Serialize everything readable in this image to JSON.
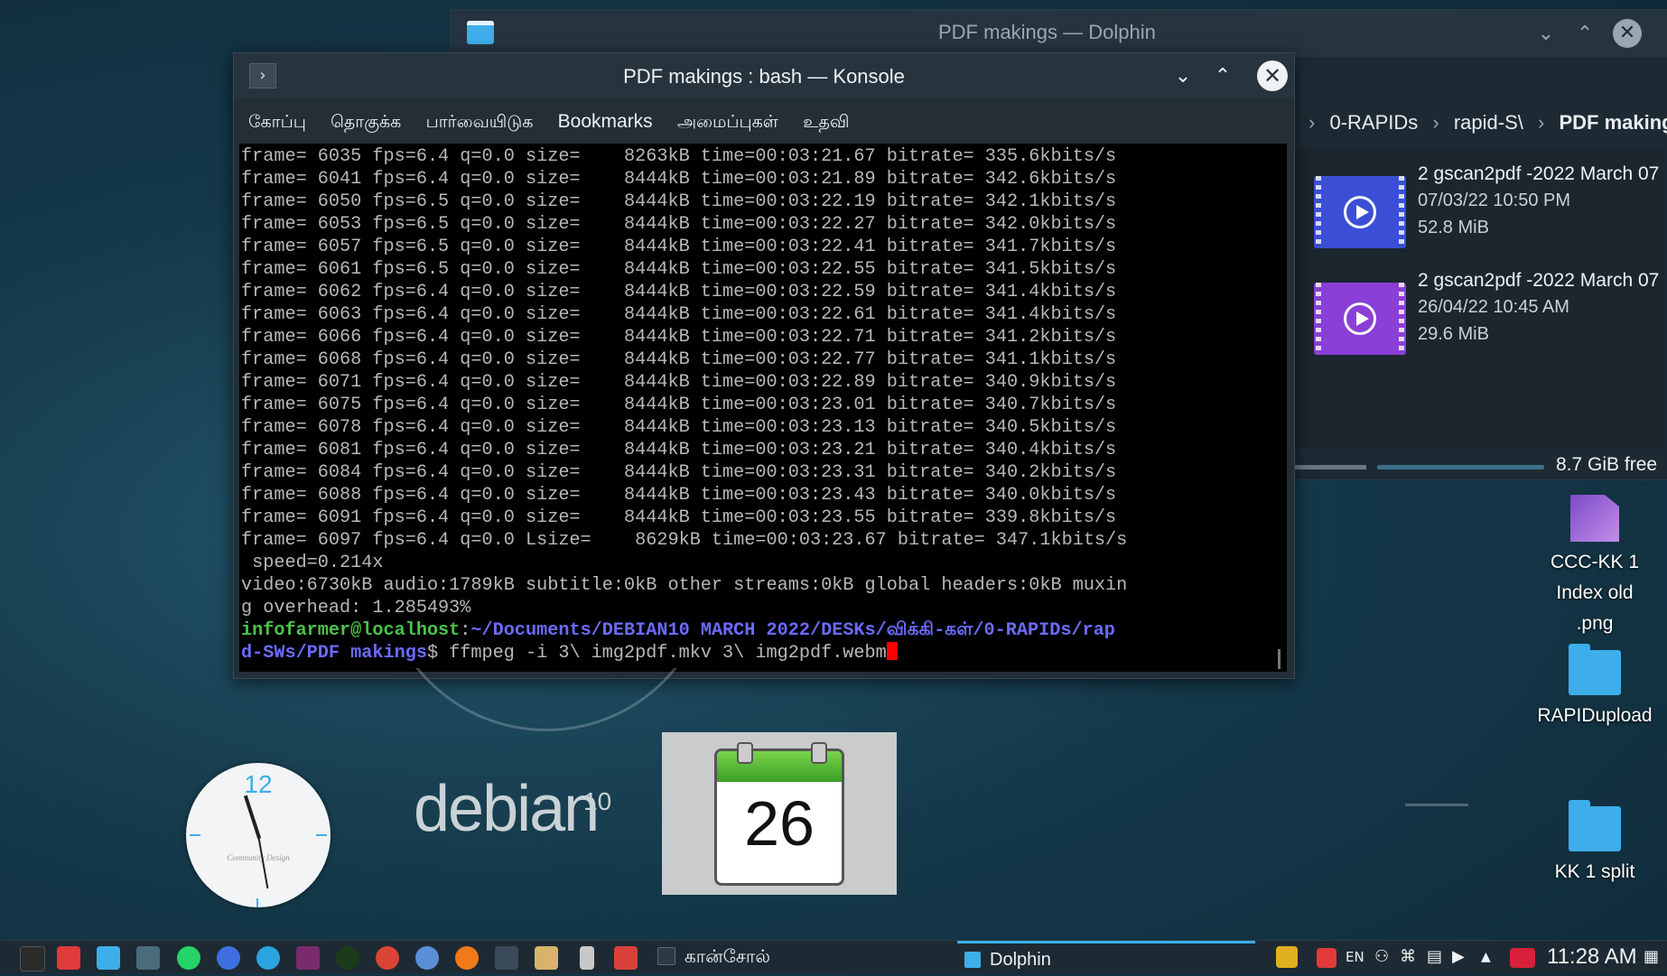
{
  "dolphin": {
    "title": "PDF makings — Dolphin",
    "breadcrumbs": [
      "0-RAPIDs",
      "rapid-S\\",
      "PDF makings"
    ],
    "files": [
      {
        "name": "2 gscan2pdf -2022 March 07",
        "date": "07/03/22 10:50 PM",
        "size": "52.8 MiB",
        "color": "#3b4fd6"
      },
      {
        "name": "2 gscan2pdf -2022 March 07",
        "date": "26/04/22 10:45 AM",
        "size": "29.6 MiB",
        "color": "#8a3fd6"
      }
    ],
    "side_char": "v",
    "free_space": "8.7 GiB free"
  },
  "konsole": {
    "title": "PDF makings : bash — Konsole",
    "menu": [
      "கோப்பு",
      "தொகுக்க",
      "பார்வையிடுக",
      "Bookmarks",
      "அமைப்புகள்",
      "உதவி"
    ],
    "output_lines": [
      "frame= 6035 fps=6.4 q=0.0 size=    8263kB time=00:03:21.67 bitrate= 335.6kbits/s",
      "frame= 6041 fps=6.4 q=0.0 size=    8444kB time=00:03:21.89 bitrate= 342.6kbits/s",
      "frame= 6050 fps=6.5 q=0.0 size=    8444kB time=00:03:22.19 bitrate= 342.1kbits/s",
      "frame= 6053 fps=6.5 q=0.0 size=    8444kB time=00:03:22.27 bitrate= 342.0kbits/s",
      "frame= 6057 fps=6.5 q=0.0 size=    8444kB time=00:03:22.41 bitrate= 341.7kbits/s",
      "frame= 6061 fps=6.5 q=0.0 size=    8444kB time=00:03:22.55 bitrate= 341.5kbits/s",
      "frame= 6062 fps=6.4 q=0.0 size=    8444kB time=00:03:22.59 bitrate= 341.4kbits/s",
      "frame= 6063 fps=6.4 q=0.0 size=    8444kB time=00:03:22.61 bitrate= 341.4kbits/s",
      "frame= 6066 fps=6.4 q=0.0 size=    8444kB time=00:03:22.71 bitrate= 341.2kbits/s",
      "frame= 6068 fps=6.4 q=0.0 size=    8444kB time=00:03:22.77 bitrate= 341.1kbits/s",
      "frame= 6071 fps=6.4 q=0.0 size=    8444kB time=00:03:22.89 bitrate= 340.9kbits/s",
      "frame= 6075 fps=6.4 q=0.0 size=    8444kB time=00:03:23.01 bitrate= 340.7kbits/s",
      "frame= 6078 fps=6.4 q=0.0 size=    8444kB time=00:03:23.13 bitrate= 340.5kbits/s",
      "frame= 6081 fps=6.4 q=0.0 size=    8444kB time=00:03:23.21 bitrate= 340.4kbits/s",
      "frame= 6084 fps=6.4 q=0.0 size=    8444kB time=00:03:23.31 bitrate= 340.2kbits/s",
      "frame= 6088 fps=6.4 q=0.0 size=    8444kB time=00:03:23.43 bitrate= 340.0kbits/s",
      "frame= 6091 fps=6.4 q=0.0 size=    8444kB time=00:03:23.55 bitrate= 339.8kbits/s",
      "frame= 6097 fps=6.4 q=0.0 Lsize=    8629kB time=00:03:23.67 bitrate= 347.1kbits/s",
      " speed=0.214x",
      "video:6730kB audio:1789kB subtitle:0kB other streams:0kB global headers:0kB muxin",
      "g overhead: 1.285493%"
    ],
    "prompt_user": "infofarmer@localhost",
    "prompt_sep": ":",
    "prompt_path_1": "~/Documents/DEBIAN10 MARCH 2022/DESKs/விக்கி-கள்/0-RAPIDs/rap",
    "prompt_path_2": "d-SWs/PDF makings",
    "prompt_dollar": "$ ",
    "command": "ffmpeg -i 3\\ img2pdf.mkv 3\\ img2pdf.webm"
  },
  "desktop": {
    "clock_twelve": "12",
    "clock_brand": "Community Design",
    "debian_text": "debian",
    "debian_version": "10",
    "calendar_day": "26",
    "icons": [
      {
        "label_1": "CCC-KK 1",
        "label_2": "Index old .png",
        "icon": "image-file-icon"
      },
      {
        "label_1": "RAPIDupload",
        "label_2": "",
        "icon": "folder-icon"
      },
      {
        "label_1": "KK 1 split",
        "label_2": "",
        "icon": "folder-icon"
      }
    ]
  },
  "taskbar": {
    "tasks": [
      {
        "label": "கான்சோல்",
        "icon": "terminal-icon"
      },
      {
        "label": "Dolphin",
        "icon": "folder-icon"
      }
    ],
    "keyboard_layout": "EN",
    "time": "11:28 AM",
    "launcher_colors": [
      "#2b2b2b",
      "#e03a3a",
      "#3daee9",
      "#4a6b7a",
      "#25d366",
      "#3d6fe0",
      "#2aa3e0",
      "#7a2b6e",
      "#1b3b1b",
      "#db4437",
      "#5a8fd8",
      "#f07a1a",
      "#3a4a5a",
      "#d7b46a",
      "#c8c8c8",
      "#d8413a"
    ]
  }
}
